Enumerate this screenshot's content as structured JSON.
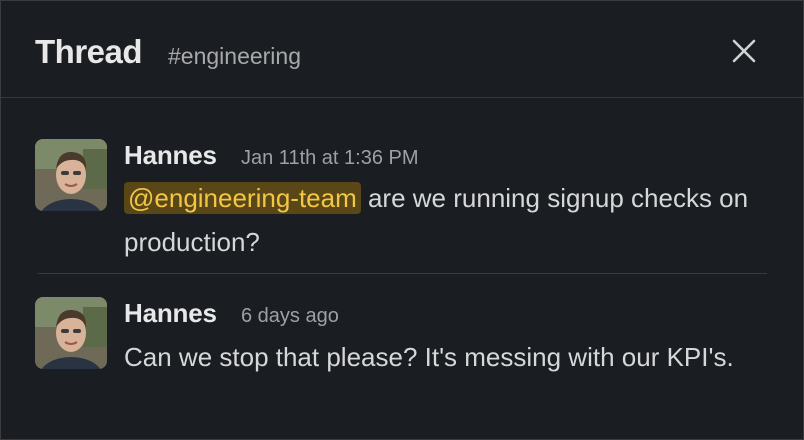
{
  "header": {
    "title": "Thread",
    "channel": "#engineering",
    "close_icon": "close-icon"
  },
  "messages": [
    {
      "author": "Hannes",
      "timestamp": "Jan 11th at 1:36 PM",
      "mention": "@engineering-team",
      "text": " are we running signup checks on production?"
    },
    {
      "author": "Hannes",
      "timestamp": "6 days ago",
      "text": "Can we stop that please? It's messing with our KPI's."
    }
  ],
  "colors": {
    "background": "#1a1d21",
    "mention_bg": "#5a4718",
    "mention_text": "#f2c744"
  }
}
